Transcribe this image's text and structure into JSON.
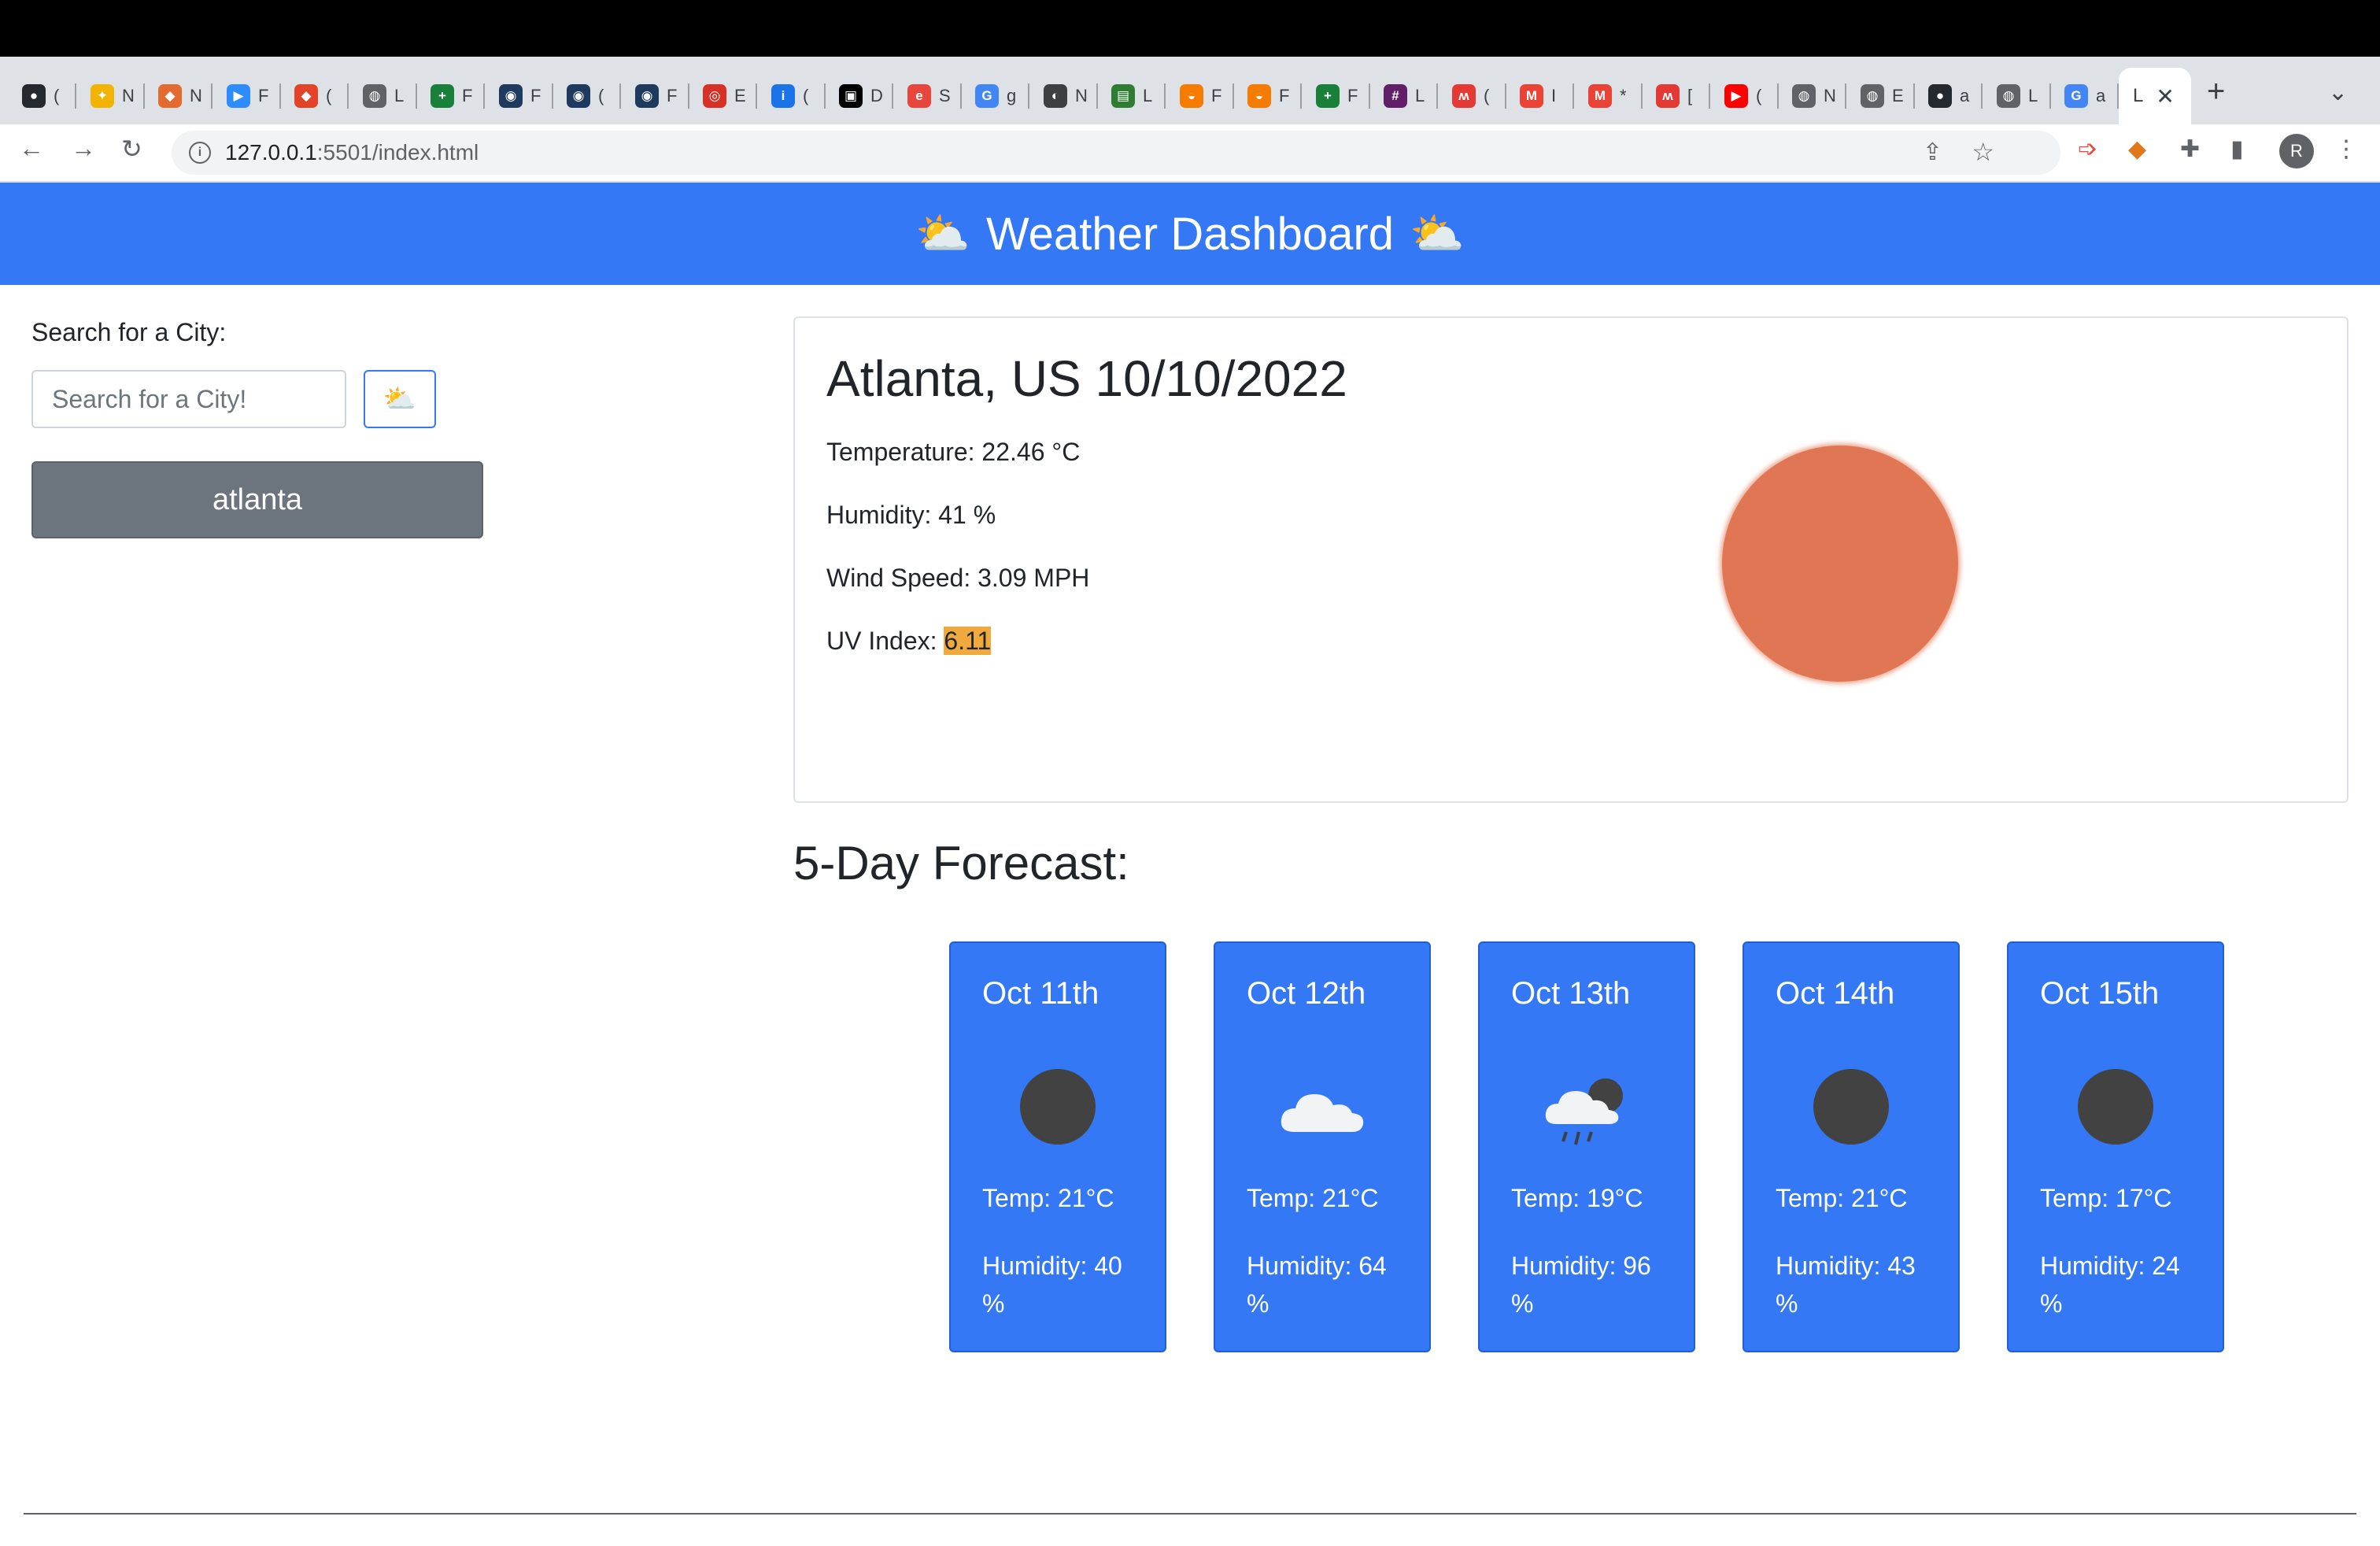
{
  "browser": {
    "tabs": [
      {
        "letter": "(",
        "color": "#24292f",
        "glyph": "●"
      },
      {
        "letter": "N",
        "color": "#f2b400",
        "glyph": "✦"
      },
      {
        "letter": "N",
        "color": "#e46b2f",
        "glyph": "◆"
      },
      {
        "letter": "F",
        "color": "#2d8cff",
        "glyph": "▶"
      },
      {
        "letter": "(",
        "color": "#e24329",
        "glyph": "◆"
      },
      {
        "letter": "L",
        "color": "#5f6368",
        "glyph": "◍"
      },
      {
        "letter": "F",
        "color": "#188038",
        "glyph": "+"
      },
      {
        "letter": "F",
        "color": "#1e3a5f",
        "glyph": "◉"
      },
      {
        "letter": "(",
        "color": "#1e3a5f",
        "glyph": "◉"
      },
      {
        "letter": "F",
        "color": "#1e3a5f",
        "glyph": "◉"
      },
      {
        "letter": "E",
        "color": "#d93025",
        "glyph": "◎"
      },
      {
        "letter": "(",
        "color": "#1a73e8",
        "glyph": "i"
      },
      {
        "letter": "D",
        "color": "#000000",
        "glyph": "▣"
      },
      {
        "letter": "S",
        "color": "#e8453c",
        "glyph": "e"
      },
      {
        "letter": "g",
        "color": "#4285f4",
        "glyph": "G"
      },
      {
        "letter": "N",
        "color": "#3c4043",
        "glyph": "◐"
      },
      {
        "letter": "L",
        "color": "#2e7d32",
        "glyph": "▤"
      },
      {
        "letter": "F",
        "color": "#f57c00",
        "glyph": "◒"
      },
      {
        "letter": "F",
        "color": "#f57c00",
        "glyph": "◒"
      },
      {
        "letter": "F",
        "color": "#188038",
        "glyph": "+"
      },
      {
        "letter": "L",
        "color": "#611f69",
        "glyph": "#"
      },
      {
        "letter": "(",
        "color": "#e53935",
        "glyph": "ʍ"
      },
      {
        "letter": "I",
        "color": "#ea4335",
        "glyph": "M"
      },
      {
        "letter": "*",
        "color": "#ea4335",
        "glyph": "M"
      },
      {
        "letter": "[",
        "color": "#e53935",
        "glyph": "ʍ"
      },
      {
        "letter": "(",
        "color": "#ff0000",
        "glyph": "▶"
      },
      {
        "letter": "N",
        "color": "#5f6368",
        "glyph": "◍"
      },
      {
        "letter": "E",
        "color": "#5f6368",
        "glyph": "◍"
      },
      {
        "letter": "a",
        "color": "#24292f",
        "glyph": "●"
      },
      {
        "letter": "L",
        "color": "#5f6368",
        "glyph": "◍"
      },
      {
        "letter": "a",
        "color": "#4285f4",
        "glyph": "G"
      }
    ],
    "active_tab": {
      "title": "L"
    },
    "url_host": "127.0.0.1",
    "url_path": ":5501/index.html",
    "profile_initial": "R"
  },
  "header": {
    "title": "Weather Dashboard",
    "icon": "sun-behind-cloud"
  },
  "sidebar": {
    "search_label": "Search for a City:",
    "search_placeholder": "Search for a City!",
    "search_button_icon": "sun-behind-cloud",
    "history": [
      "atlanta"
    ]
  },
  "current": {
    "heading": "Atlanta, US 10/10/2022",
    "temperature": "Temperature: 22.46 °C",
    "humidity": "Humidity: 41 %",
    "wind": "Wind Speed: 3.09 MPH",
    "uv_label": "UV Index: ",
    "uv_value": "6.11",
    "uv_color": "#f0a93c",
    "icon": "clear-sky-sun",
    "icon_color": "#e07654"
  },
  "forecast": {
    "title": "5-Day Forecast:",
    "accent": "#3478f6",
    "days": [
      {
        "date": "Oct 11th",
        "icon": "clear-sky-dot",
        "temp": "Temp: 21°C",
        "humidity": "Humidity: 40 %"
      },
      {
        "date": "Oct 12th",
        "icon": "cloud",
        "temp": "Temp: 21°C",
        "humidity": "Humidity: 64 %"
      },
      {
        "date": "Oct 13th",
        "icon": "rain-cloud",
        "temp": "Temp: 19°C",
        "humidity": "Humidity: 96 %"
      },
      {
        "date": "Oct 14th",
        "icon": "clear-sky-dot",
        "temp": "Temp: 21°C",
        "humidity": "Humidity: 43 %"
      },
      {
        "date": "Oct 15th",
        "icon": "clear-sky-dot",
        "temp": "Temp: 17°C",
        "humidity": "Humidity: 24 %"
      }
    ]
  }
}
